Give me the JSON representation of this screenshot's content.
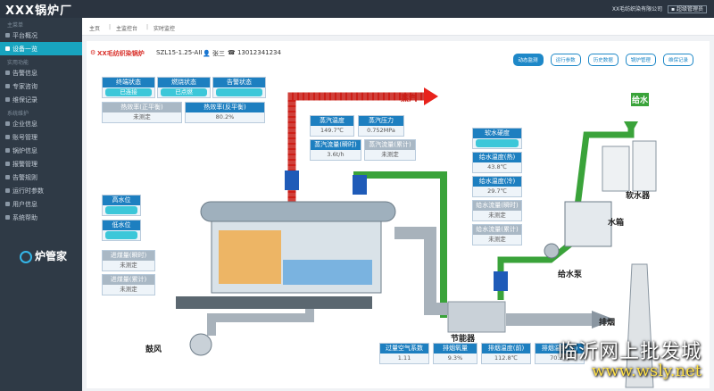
{
  "app": {
    "brand": "XXX锅炉厂",
    "company": "XX毛纺织染有限公司",
    "role": "超级管理员",
    "logo_text": "炉管家"
  },
  "sidebar": {
    "groups": [
      {
        "title": "主菜单",
        "items": [
          {
            "label": "平台概况",
            "active": false
          },
          {
            "label": "设备一览",
            "active": true
          }
        ]
      },
      {
        "title": "实用功能",
        "items": [
          {
            "label": "告警信息",
            "active": false
          },
          {
            "label": "专家咨询",
            "active": false
          },
          {
            "label": "维保记录",
            "active": false
          }
        ]
      },
      {
        "title": "系统维护",
        "items": [
          {
            "label": "企业信息",
            "active": false
          },
          {
            "label": "账号管理",
            "active": false
          },
          {
            "label": "锅炉信息",
            "active": false
          },
          {
            "label": "报警管理",
            "active": false
          },
          {
            "label": "告警规则",
            "active": false
          },
          {
            "label": "运行时参数",
            "active": false
          },
          {
            "label": "用户信息",
            "active": false
          },
          {
            "label": "系统帮助",
            "active": false
          }
        ]
      }
    ]
  },
  "breadcrumb": [
    "主页",
    "主监控台",
    "实时监控"
  ],
  "header": {
    "title": "XX毛纺织染锅炉",
    "model": "SZL15-1.25-AII",
    "user": "张三",
    "phone": "13012341234"
  },
  "tabs": [
    {
      "label": "动态监测",
      "active": true
    },
    {
      "label": "运行参数",
      "active": false
    },
    {
      "label": "历史数据",
      "active": false
    },
    {
      "label": "锅炉管理",
      "active": false
    },
    {
      "label": "维保记录",
      "active": false
    }
  ],
  "status": {
    "run_label": "终端状态",
    "run_value": "已连接",
    "fire_label": "燃烧状态",
    "fire_value": "已点燃",
    "alarm_label": "告警状态",
    "alarm_value": ""
  },
  "efficiency": {
    "pos_label": "热效率(正平衡)",
    "pos_value": "未测定",
    "neg_label": "热效率(反平衡)",
    "neg_value": "80.2%"
  },
  "steam": {
    "temp_label": "蒸汽温度",
    "temp_value": "149.7℃",
    "press_label": "蒸汽压力",
    "press_value": "0.752MPa",
    "flow_label": "蒸汽流量(瞬时)",
    "flow_value": "3.6t/h",
    "total_label": "蒸汽流量(累计)",
    "total_value": "未测定"
  },
  "water_level": {
    "high_label": "高水位",
    "low_label": "低水位"
  },
  "coal": {
    "inst_label": "进煤量(瞬时)",
    "inst_value": "未测定",
    "total_label": "进煤量(累计)",
    "total_value": "未测定"
  },
  "water": {
    "hard_label": "软水硬度",
    "hot_label": "给水温度(热)",
    "hot_value": "43.8℃",
    "cold_label": "给水温度(冷)",
    "cold_value": "29.7℃",
    "inst_label": "给水流量(瞬时)",
    "inst_value": "未测定",
    "total_label": "给水流量(累计)",
    "total_value": "未测定"
  },
  "flue": {
    "air_label": "过量空气系数",
    "air_value": "1.11",
    "o2_label": "排烟氧量",
    "o2_value": "9.3%",
    "temp_label": "排烟温度(前)",
    "temp_value": "112.8℃",
    "temp2_label": "排烟温度(后)",
    "temp2_value": "70.2℃"
  },
  "diagram": {
    "steam": "蒸汽",
    "feed_water": "给水",
    "softener": "软水器",
    "tank": "水箱",
    "pump": "给水泵",
    "economizer": "节能器",
    "exhaust": "排烟",
    "blower": "鼓风"
  },
  "watermark": {
    "line1": "临沂网上批发城",
    "line2": "www.wsly.net"
  },
  "colors": {
    "steam_pipe": "#e8231c",
    "water_pipe": "#3aa33a",
    "accent": "#1d7fc0",
    "sidebar": "#2f3a46"
  }
}
